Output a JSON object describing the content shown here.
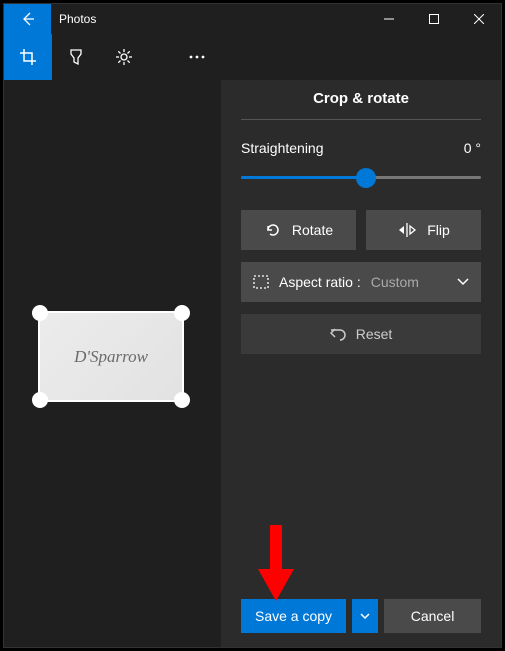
{
  "window": {
    "title": "Photos"
  },
  "panel": {
    "title": "Crop & rotate",
    "straighten_label": "Straightening",
    "straighten_value": "0 °",
    "rotate_label": "Rotate",
    "flip_label": "Flip",
    "aspect_label": "Aspect ratio :",
    "aspect_value": "Custom",
    "reset_label": "Reset",
    "save_label": "Save a copy",
    "cancel_label": "Cancel"
  },
  "canvas": {
    "signature_text": "D'Sparrow"
  }
}
